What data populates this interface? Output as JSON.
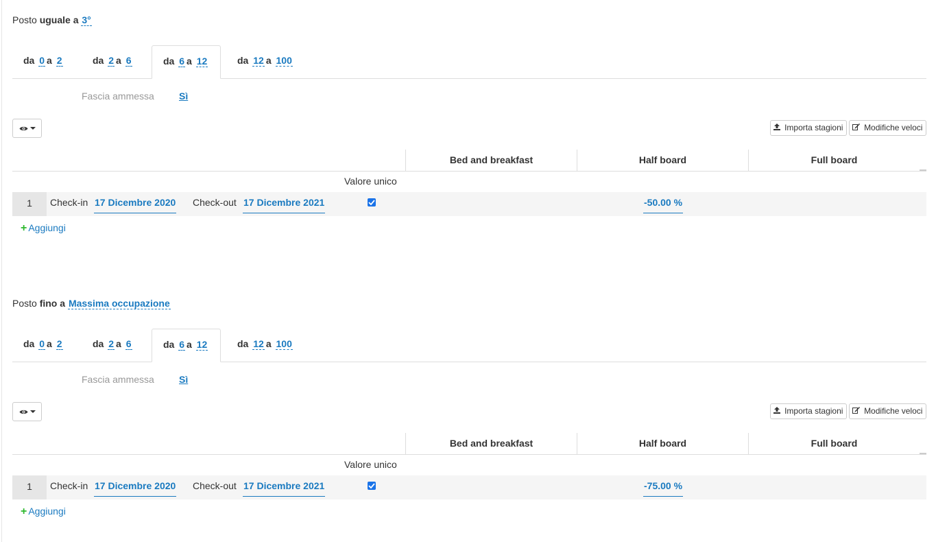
{
  "sections": [
    {
      "posto_prefix": "Posto",
      "posto_bold": "uguale a",
      "posto_value": "3°",
      "tabs": [
        {
          "da": "da",
          "from": "0",
          "a": "a",
          "to": "2"
        },
        {
          "da": "da",
          "from": "2",
          "a": "a",
          "to": "6"
        },
        {
          "da": "da",
          "from": "6",
          "a": "a",
          "to": "12"
        },
        {
          "da": "da",
          "from": "12",
          "a": "a",
          "to": "100"
        }
      ],
      "active_tab": 2,
      "fascia_label": "Fascia ammessa",
      "fascia_value": "Sì",
      "import_label": "Importa stagioni",
      "quick_edit_label": "Modifiche veloci",
      "columns": [
        "Bed and breakfast",
        "Half board",
        "Full board"
      ],
      "valore_unico_label": "Valore unico",
      "rows": [
        {
          "index": "1",
          "checkin_label": "Check-in",
          "checkin_value": "17 Dicembre 2020",
          "checkout_label": "Check-out",
          "checkout_value": "17 Dicembre 2021",
          "valore_unico_checked": true,
          "half_board": "-50.00 %"
        }
      ],
      "add_label": "Aggiungi"
    },
    {
      "posto_prefix": "Posto",
      "posto_bold": "fino a",
      "posto_value": "Massima occupazione",
      "tabs": [
        {
          "da": "da",
          "from": "0",
          "a": "a",
          "to": "2"
        },
        {
          "da": "da",
          "from": "2",
          "a": "a",
          "to": "6"
        },
        {
          "da": "da",
          "from": "6",
          "a": "a",
          "to": "12"
        },
        {
          "da": "da",
          "from": "12",
          "a": "a",
          "to": "100"
        }
      ],
      "active_tab": 2,
      "fascia_label": "Fascia ammessa",
      "fascia_value": "Sì",
      "import_label": "Importa stagioni",
      "quick_edit_label": "Modifiche veloci",
      "columns": [
        "Bed and breakfast",
        "Half board",
        "Full board"
      ],
      "valore_unico_label": "Valore unico",
      "rows": [
        {
          "index": "1",
          "checkin_label": "Check-in",
          "checkin_value": "17 Dicembre 2020",
          "checkout_label": "Check-out",
          "checkout_value": "17 Dicembre 2021",
          "valore_unico_checked": true,
          "half_board": "-75.00 %"
        }
      ],
      "add_label": "Aggiungi"
    }
  ],
  "icons": {
    "view": "eye-icon",
    "import": "upload-icon",
    "quick_edit": "edit-icon",
    "add": "plus-icon",
    "checkbox": "check-icon"
  },
  "colors": {
    "link": "#1a7ac0",
    "add_plus": "#2eb82e",
    "checkbox": "#1a73e8",
    "muted_label": "#999999"
  }
}
